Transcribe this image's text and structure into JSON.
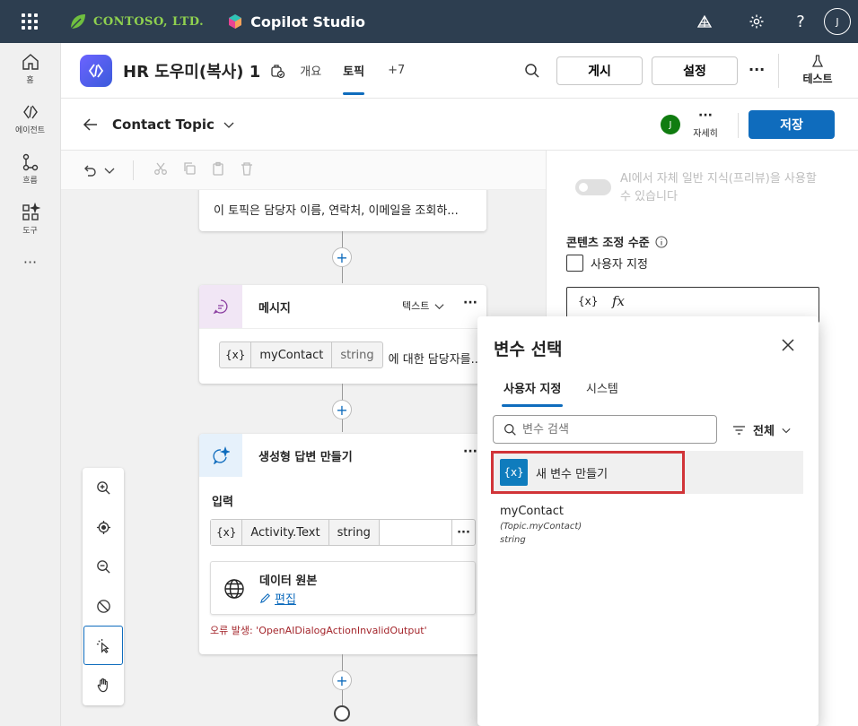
{
  "topbar": {
    "company": "CONTOSO, LTD.",
    "product": "Copilot Studio",
    "avatar": "J"
  },
  "rail": [
    {
      "label": "홈",
      "icon": "home-icon"
    },
    {
      "label": "에이전트",
      "icon": "agent-icon"
    },
    {
      "label": "흐름",
      "icon": "flow-icon"
    },
    {
      "label": "도구",
      "icon": "tools-icon"
    }
  ],
  "agent": {
    "name": "HR 도우미(복사) 1",
    "tabs": [
      "개요",
      "토픽",
      "+7"
    ],
    "publish": "게시",
    "settings": "설정",
    "more": "···",
    "test": "테스트"
  },
  "topic": {
    "name": "Contact Topic",
    "avatar": "J",
    "details": "자세히",
    "save": "저장"
  },
  "canvas": {
    "trigger_desc": "이 토픽은 담당자 이름, 연락처, 이메일을 조회하...",
    "message_node": {
      "title": "메시지",
      "type_label": "텍스트",
      "var_tag": "{x}",
      "var_name": "myContact",
      "var_type": "string",
      "after_text": "에 대한 담당자를..."
    },
    "gen_node": {
      "title": "생성형 답변 만들기",
      "input_label": "입력",
      "var_tag": "{x}",
      "var_name": "Activity.Text",
      "var_type": "string",
      "source_title": "데이터 원본",
      "edit_label": "편집",
      "error": "오류 발생: 'OpenAIDialogActionInvalidOutput'"
    }
  },
  "props": {
    "ai_toggle_label": "AI에서 자체 일반 지식(프리뷰)을 사용할 수 있습니다",
    "moderation_label": "콘텐츠 조정 수준",
    "custom_label": "사용자 지정",
    "var_btn": "{x}",
    "fx_btn": "fx"
  },
  "picker": {
    "title": "변수 선택",
    "tabs": [
      "사용자 지정",
      "시스템"
    ],
    "search_placeholder": "변수 검색",
    "filter_label": "전체",
    "new_var_tag": "{x}",
    "new_var_label": "새 변수 만들기",
    "items": [
      {
        "name": "myContact",
        "path": "(Topic.myContact)",
        "type": "string"
      }
    ]
  }
}
